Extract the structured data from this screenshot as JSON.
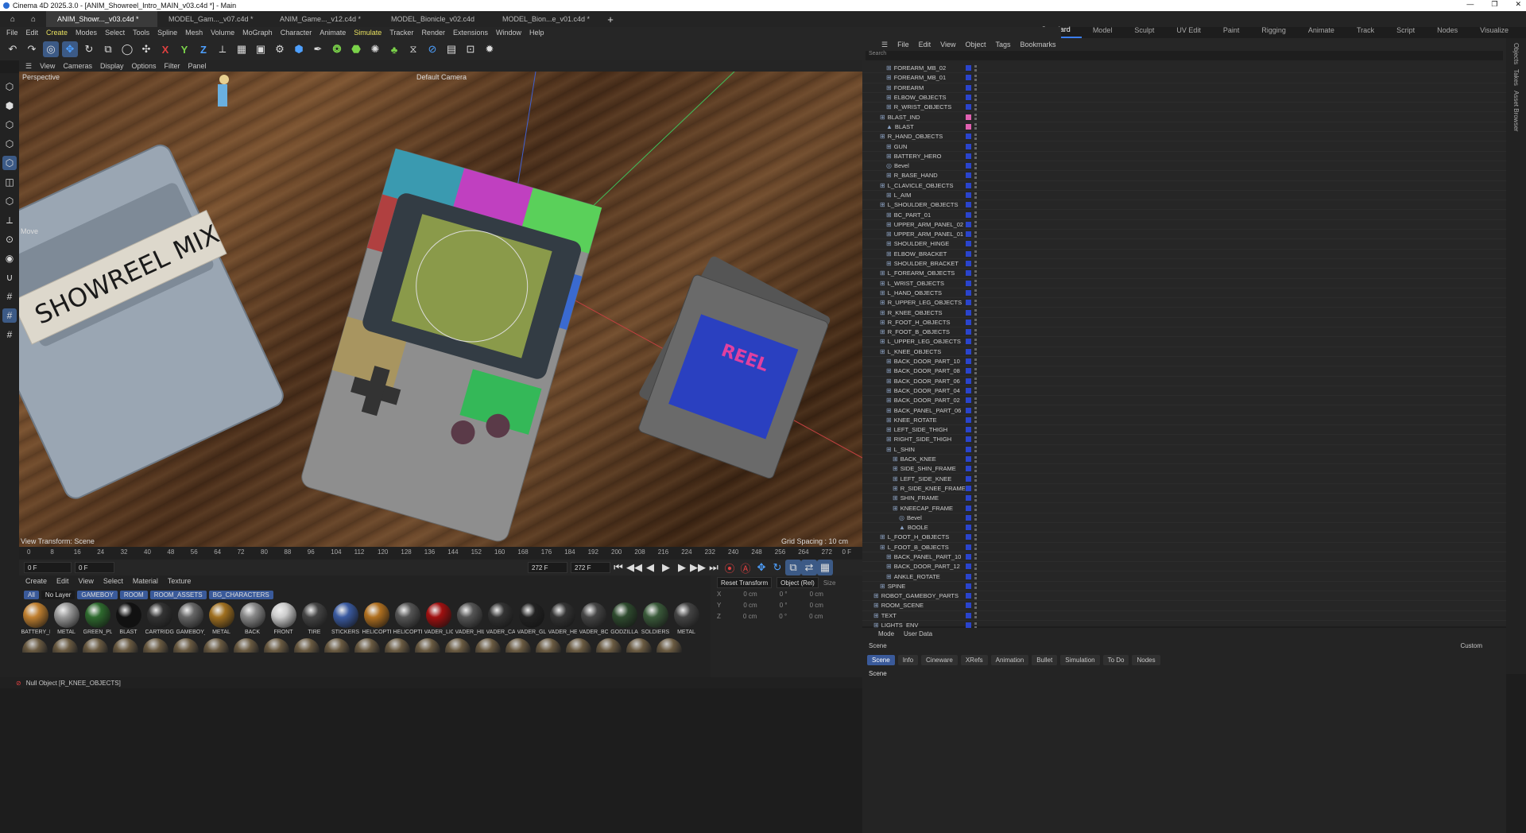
{
  "window": {
    "title": "Cinema 4D 2025.3.0 - [ANIM_Showreel_Intro_MAIN_v03.c4d *] - Main"
  },
  "file_tabs": [
    "ANIM_Showr..._v03.c4d *",
    "MODEL_Gam..._v07.c4d *",
    "ANIM_Game..._v12.c4d *",
    "MODEL_Bionicle_v02.c4d",
    "MODEL_Bion...e_v01.c4d *"
  ],
  "layouts": [
    "Standard",
    "Model",
    "Sculpt",
    "UV Edit",
    "Paint",
    "Rigging",
    "Animate",
    "Track",
    "Script",
    "Nodes",
    "Visualize"
  ],
  "main_menu": [
    "File",
    "Edit",
    "Create",
    "Modes",
    "Select",
    "Tools",
    "Spline",
    "Mesh",
    "Volume",
    "MoGraph",
    "Character",
    "Animate",
    "Simulate",
    "Tracker",
    "Render",
    "Extensions",
    "Window",
    "Help"
  ],
  "main_menu_highlight": [
    "Create",
    "Simulate"
  ],
  "viewport_menu": [
    "View",
    "Cameras",
    "Display",
    "Options",
    "Filter",
    "Panel"
  ],
  "viewport": {
    "projection": "Perspective",
    "camera": "Default Camera",
    "tool": "Move",
    "view_transform": "View Transform: Scene",
    "grid_spacing": "Grid Spacing : 10 cm",
    "cassette_label": "SHOWREEL MIX",
    "cartridge_label": "REEL"
  },
  "timeline": {
    "ticks": [
      "0",
      "8",
      "16",
      "24",
      "32",
      "40",
      "48",
      "56",
      "64",
      "72",
      "80",
      "88",
      "96",
      "104",
      "112",
      "120",
      "128",
      "136",
      "144",
      "152",
      "160",
      "168",
      "176",
      "184",
      "192",
      "200",
      "208",
      "216",
      "224",
      "232",
      "240",
      "248",
      "256",
      "264",
      "272"
    ],
    "end_frame_label": "0 F",
    "current_frame": "0 F",
    "preview_start": "0 F",
    "end_a": "272 F",
    "end_b": "272 F"
  },
  "material_menu": [
    "Create",
    "Edit",
    "View",
    "Select",
    "Material",
    "Texture"
  ],
  "material_filters": [
    "All",
    "No Layer",
    "GAMEBOY",
    "ROOM",
    "ROOM_ASSETS",
    "BG_CHARACTERS"
  ],
  "materials": [
    "BATTERY_LI",
    "METAL",
    "GREEN_PLA",
    "BLAST",
    "CARTRIDGE",
    "GAMEBOY_",
    "METAL",
    "BACK",
    "FRONT",
    "TIRE",
    "STICKERS",
    "HELICOPTEI",
    "HELICOPTEI",
    "VADER_LIGI",
    "VADER_HILI",
    "VADER_CAF",
    "VADER_GLC",
    "VADER_HEL",
    "VADER_BOI",
    "GODZILLA",
    "SOLDIERS",
    "METAL"
  ],
  "coords": {
    "reset": "Reset Transform",
    "mode": "Object (Rel)",
    "size": "Size",
    "rows": [
      {
        "axis": "X",
        "pos": "0 cm",
        "rot": "0 °",
        "size": "0 cm"
      },
      {
        "axis": "Y",
        "pos": "0 cm",
        "rot": "0 °",
        "size": "0 cm"
      },
      {
        "axis": "Z",
        "pos": "0 cm",
        "rot": "0 °",
        "size": "0 cm"
      }
    ]
  },
  "status": "Null Object [R_KNEE_OBJECTS]",
  "object_manager": {
    "menu": [
      "File",
      "Edit",
      "View",
      "Object",
      "Tags",
      "Bookmarks"
    ],
    "search_placeholder": "Search",
    "rows": [
      {
        "name": "FOREARM_MB_02",
        "indent": 3
      },
      {
        "name": "FOREARM_MB_01",
        "indent": 3
      },
      {
        "name": "FOREARM",
        "indent": 3
      },
      {
        "name": "ELBOW_OBJECTS",
        "indent": 3
      },
      {
        "name": "R_WRIST_OBJECTS",
        "indent": 3
      },
      {
        "name": "BLAST_IND",
        "indent": 2
      },
      {
        "name": "BLAST",
        "indent": 3
      },
      {
        "name": "R_HAND_OBJECTS",
        "indent": 2
      },
      {
        "name": "GUN",
        "indent": 3
      },
      {
        "name": "BATTERY_HERO",
        "indent": 3
      },
      {
        "name": "Bevel",
        "indent": 3
      },
      {
        "name": "R_BASE_HAND",
        "indent": 3
      },
      {
        "name": "L_CLAVICLE_OBJECTS",
        "indent": 2
      },
      {
        "name": "L_AIM",
        "indent": 3
      },
      {
        "name": "L_SHOULDER_OBJECTS",
        "indent": 2
      },
      {
        "name": "BC_PART_01",
        "indent": 3
      },
      {
        "name": "UPPER_ARM_PANEL_02",
        "indent": 3
      },
      {
        "name": "UPPER_ARM_PANEL_01",
        "indent": 3
      },
      {
        "name": "SHOULDER_HINGE",
        "indent": 3
      },
      {
        "name": "ELBOW_BRACKET",
        "indent": 3
      },
      {
        "name": "SHOULDER_BRACKET",
        "indent": 3
      },
      {
        "name": "L_FOREARM_OBJECTS",
        "indent": 2
      },
      {
        "name": "L_WRIST_OBJECTS",
        "indent": 2
      },
      {
        "name": "L_HAND_OBJECTS",
        "indent": 2
      },
      {
        "name": "R_UPPER_LEG_OBJECTS",
        "indent": 2
      },
      {
        "name": "R_KNEE_OBJECTS",
        "indent": 2
      },
      {
        "name": "R_FOOT_H_OBJECTS",
        "indent": 2
      },
      {
        "name": "R_FOOT_B_OBJECTS",
        "indent": 2
      },
      {
        "name": "L_UPPER_LEG_OBJECTS",
        "indent": 2
      },
      {
        "name": "L_KNEE_OBJECTS",
        "indent": 2
      },
      {
        "name": "BACK_DOOR_PART_10",
        "indent": 3
      },
      {
        "name": "BACK_DOOR_PART_08",
        "indent": 3
      },
      {
        "name": "BACK_DOOR_PART_06",
        "indent": 3
      },
      {
        "name": "BACK_DOOR_PART_04",
        "indent": 3
      },
      {
        "name": "BACK_DOOR_PART_02",
        "indent": 3
      },
      {
        "name": "BACK_PANEL_PART_06",
        "indent": 3
      },
      {
        "name": "KNEE_ROTATE",
        "indent": 3
      },
      {
        "name": "LEFT_SIDE_THIGH",
        "indent": 3
      },
      {
        "name": "RIGHT_SIDE_THIGH",
        "indent": 3
      },
      {
        "name": "L_SHIN",
        "indent": 3
      },
      {
        "name": "BACK_KNEE",
        "indent": 4
      },
      {
        "name": "SIDE_SHIN_FRAME",
        "indent": 4
      },
      {
        "name": "LEFT_SIDE_KNEE",
        "indent": 4
      },
      {
        "name": "R_SIDE_KNEE_FRAME",
        "indent": 4
      },
      {
        "name": "SHIN_FRAME",
        "indent": 4
      },
      {
        "name": "KNEECAP_FRAME",
        "indent": 4
      },
      {
        "name": "Bevel",
        "indent": 5
      },
      {
        "name": "BOOLE",
        "indent": 5
      },
      {
        "name": "L_FOOT_H_OBJECTS",
        "indent": 2
      },
      {
        "name": "L_FOOT_B_OBJECTS",
        "indent": 2
      },
      {
        "name": "BACK_PANEL_PART_10",
        "indent": 3
      },
      {
        "name": "BACK_DOOR_PART_12",
        "indent": 3
      },
      {
        "name": "ANKLE_ROTATE",
        "indent": 3
      },
      {
        "name": "SPINE",
        "indent": 2
      },
      {
        "name": "ROBOT_GAMEBOY_PARTS",
        "indent": 1
      },
      {
        "name": "ROOM_SCENE",
        "indent": 1
      },
      {
        "name": "TEXT",
        "indent": 1
      },
      {
        "name": "LIGHTS_ENV",
        "indent": 1
      }
    ]
  },
  "side_tabs": [
    "Objects",
    "Takes",
    "Asset Browser"
  ],
  "attributes": {
    "menu": [
      "Mode",
      "User Data"
    ],
    "section": "Scene",
    "custom": "Custom",
    "tabs": [
      "Scene",
      "Info",
      "Cineware",
      "XRefs",
      "Animation",
      "Bullet",
      "Simulation",
      "To Do",
      "Nodes"
    ],
    "heading": "Scene"
  },
  "colors": {
    "accent": "#3c7ef0",
    "layer_blue": "#2a44cc",
    "layer_pink": "#e060b0"
  }
}
